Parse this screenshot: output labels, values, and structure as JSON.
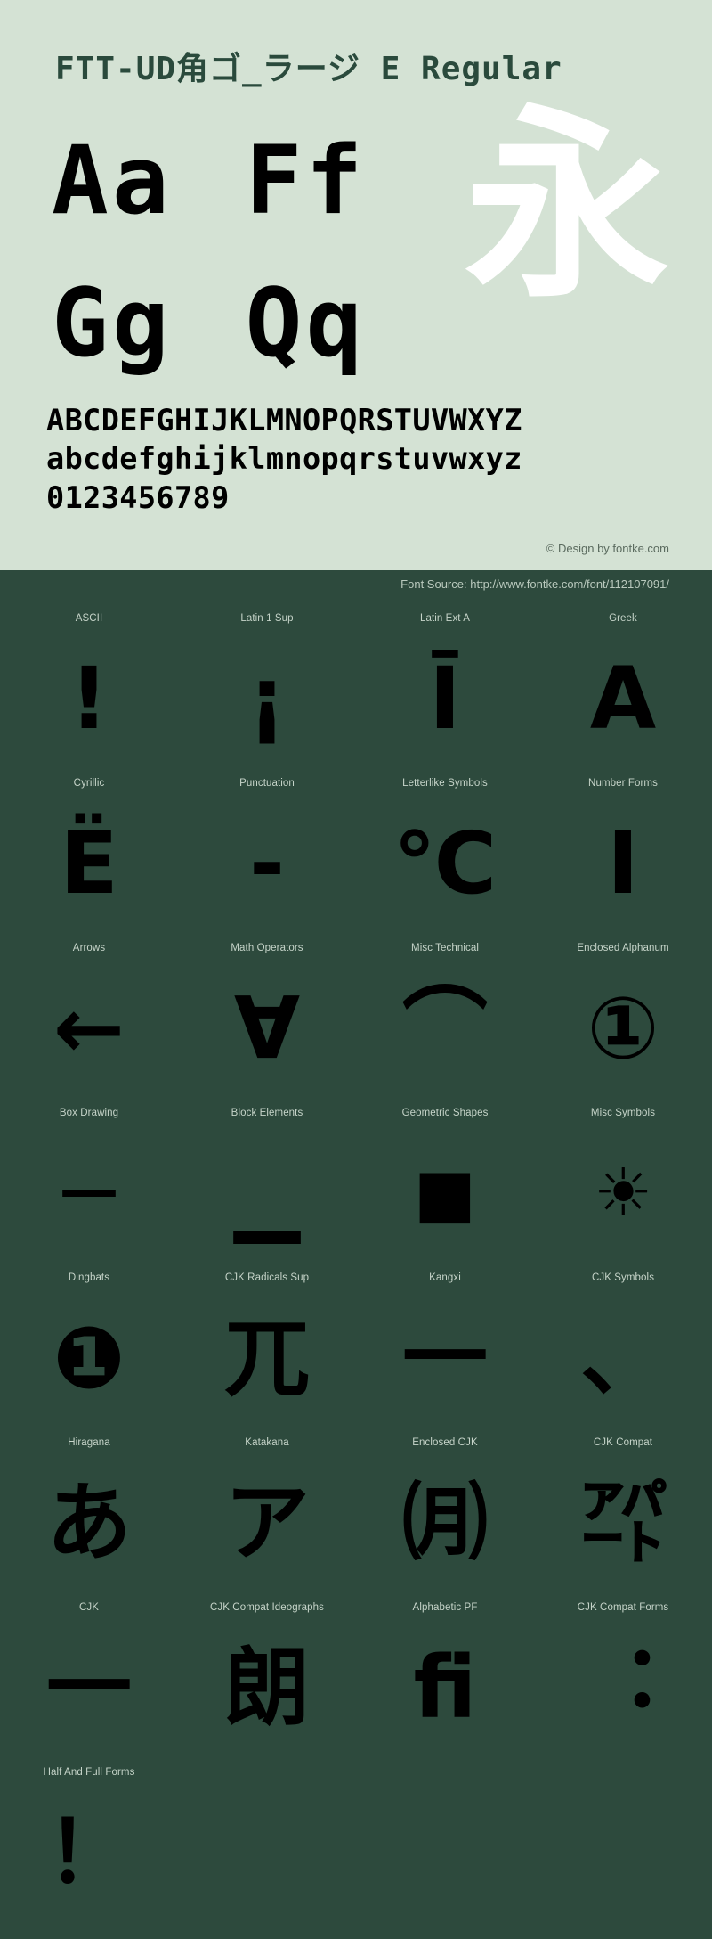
{
  "header": {
    "font_title": "FTT-UD角ゴ_ラージ E Regular"
  },
  "specimen": {
    "pair_row_1_a": "Aa",
    "pair_row_1_b": "Ff",
    "pair_row_2_a": "Gg",
    "pair_row_2_b": "Qq",
    "cjk_sample": "永",
    "uppercase": "ABCDEFGHIJKLMNOPQRSTUVWXYZ",
    "lowercase": "abcdefghijklmnopqrstuvwxyz",
    "digits": "0123456789",
    "copyright": "© Design by fontke.com"
  },
  "source": {
    "text": "Font Source: http://www.fontke.com/font/112107091/"
  },
  "colors": {
    "specimen_bg": "#d4e2d4",
    "panel_bg": "#2d4a3d",
    "title_color": "#2a4a3c",
    "glyph_color": "#000000",
    "cjk_sample_color": "#ffffff",
    "label_color": "#c6d4c9"
  },
  "blocks": [
    [
      {
        "label": "ASCII",
        "glyph": "!",
        "size": ""
      },
      {
        "label": "Latin 1 Sup",
        "glyph": "¡",
        "size": ""
      },
      {
        "label": "Latin Ext A",
        "glyph": "Ī",
        "size": ""
      },
      {
        "label": "Greek",
        "glyph": "Α",
        "size": ""
      }
    ],
    [
      {
        "label": "Cyrillic",
        "glyph": "Ё",
        "size": ""
      },
      {
        "label": "Punctuation",
        "glyph": "‐",
        "size": ""
      },
      {
        "label": "Letterlike Symbols",
        "glyph": "℃",
        "size": ""
      },
      {
        "label": "Number Forms",
        "glyph": "Ⅰ",
        "size": ""
      }
    ],
    [
      {
        "label": "Arrows",
        "glyph": "←",
        "size": ""
      },
      {
        "label": "Math Operators",
        "glyph": "∀",
        "size": ""
      },
      {
        "label": "Misc Technical",
        "glyph": "⌒",
        "size": ""
      },
      {
        "label": "Enclosed Alphanum",
        "glyph": "①",
        "size": ""
      }
    ],
    [
      {
        "label": "Box Drawing",
        "glyph": "─",
        "size": ""
      },
      {
        "label": "Block Elements",
        "glyph": "▁",
        "size": ""
      },
      {
        "label": "Geometric Shapes",
        "glyph": "■",
        "size": "small"
      },
      {
        "label": "Misc Symbols",
        "glyph": "☀",
        "size": "small"
      }
    ],
    [
      {
        "label": "Dingbats",
        "glyph": "❶",
        "size": ""
      },
      {
        "label": "CJK Radicals Sup",
        "glyph": "兀",
        "size": ""
      },
      {
        "label": "Kangxi",
        "glyph": "⼀",
        "size": ""
      },
      {
        "label": "CJK Symbols",
        "glyph": "、",
        "size": ""
      }
    ],
    [
      {
        "label": "Hiragana",
        "glyph": "あ",
        "size": ""
      },
      {
        "label": "Katakana",
        "glyph": "ア",
        "size": ""
      },
      {
        "label": "Enclosed CJK",
        "glyph": "㈪",
        "size": ""
      },
      {
        "label": "CJK Compat",
        "glyph": "㌀",
        "size": ""
      }
    ],
    [
      {
        "label": "CJK",
        "glyph": "一",
        "size": ""
      },
      {
        "label": "CJK Compat Ideographs",
        "glyph": "朗",
        "size": ""
      },
      {
        "label": "Alphabetic PF",
        "glyph": "ﬁ",
        "size": ""
      },
      {
        "label": "CJK Compat Forms",
        "glyph": "︓",
        "size": ""
      }
    ],
    [
      {
        "label": "Half And Full Forms",
        "glyph": "！",
        "size": ""
      }
    ]
  ]
}
